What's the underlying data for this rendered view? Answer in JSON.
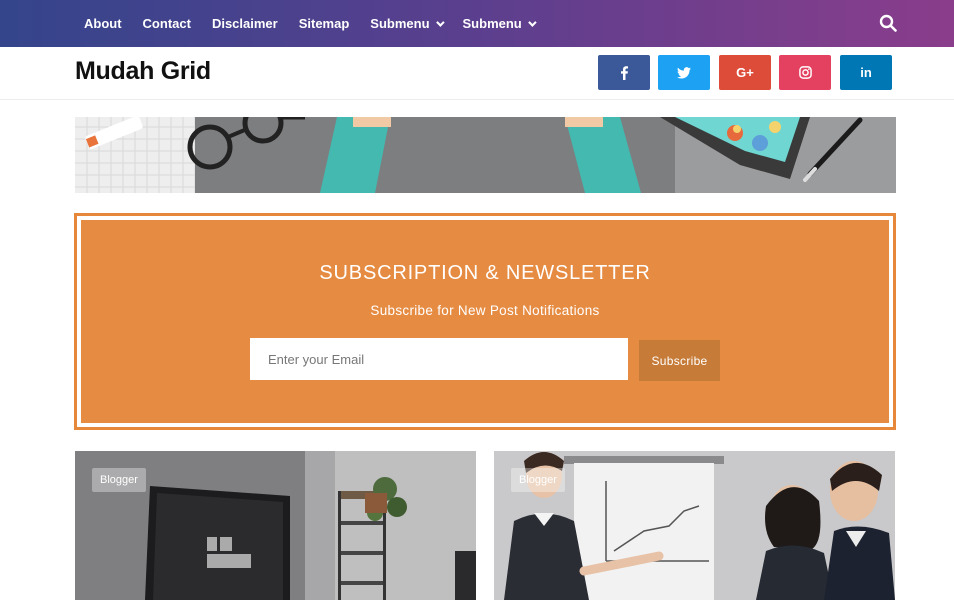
{
  "nav": {
    "items": [
      {
        "label": "About",
        "has_submenu": false
      },
      {
        "label": "Contact",
        "has_submenu": false
      },
      {
        "label": "Disclaimer",
        "has_submenu": false
      },
      {
        "label": "Sitemap",
        "has_submenu": false
      },
      {
        "label": "Submenu",
        "has_submenu": true
      },
      {
        "label": "Submenu",
        "has_submenu": true
      }
    ],
    "search_icon": "search-icon"
  },
  "header": {
    "logo": "Mudah Grid",
    "social": [
      {
        "name": "facebook",
        "glyph": "f",
        "color": "#3b5998"
      },
      {
        "name": "twitter",
        "glyph": "t",
        "color": "#1da1f2"
      },
      {
        "name": "google-plus",
        "glyph": "G+",
        "color": "#dd4b39"
      },
      {
        "name": "instagram",
        "glyph": "ig",
        "color": "#e4405f"
      },
      {
        "name": "linkedin",
        "glyph": "in",
        "color": "#0077b5"
      }
    ]
  },
  "newsletter": {
    "title": "SUBSCRIPTION & NEWSLETTER",
    "subtitle": "Subscribe for New Post Notifications",
    "input_placeholder": "Enter your Email",
    "button_label": "Subscribe",
    "accent_color": "#e68b42"
  },
  "posts": [
    {
      "category": "Blogger"
    },
    {
      "category": "Blogger"
    }
  ]
}
